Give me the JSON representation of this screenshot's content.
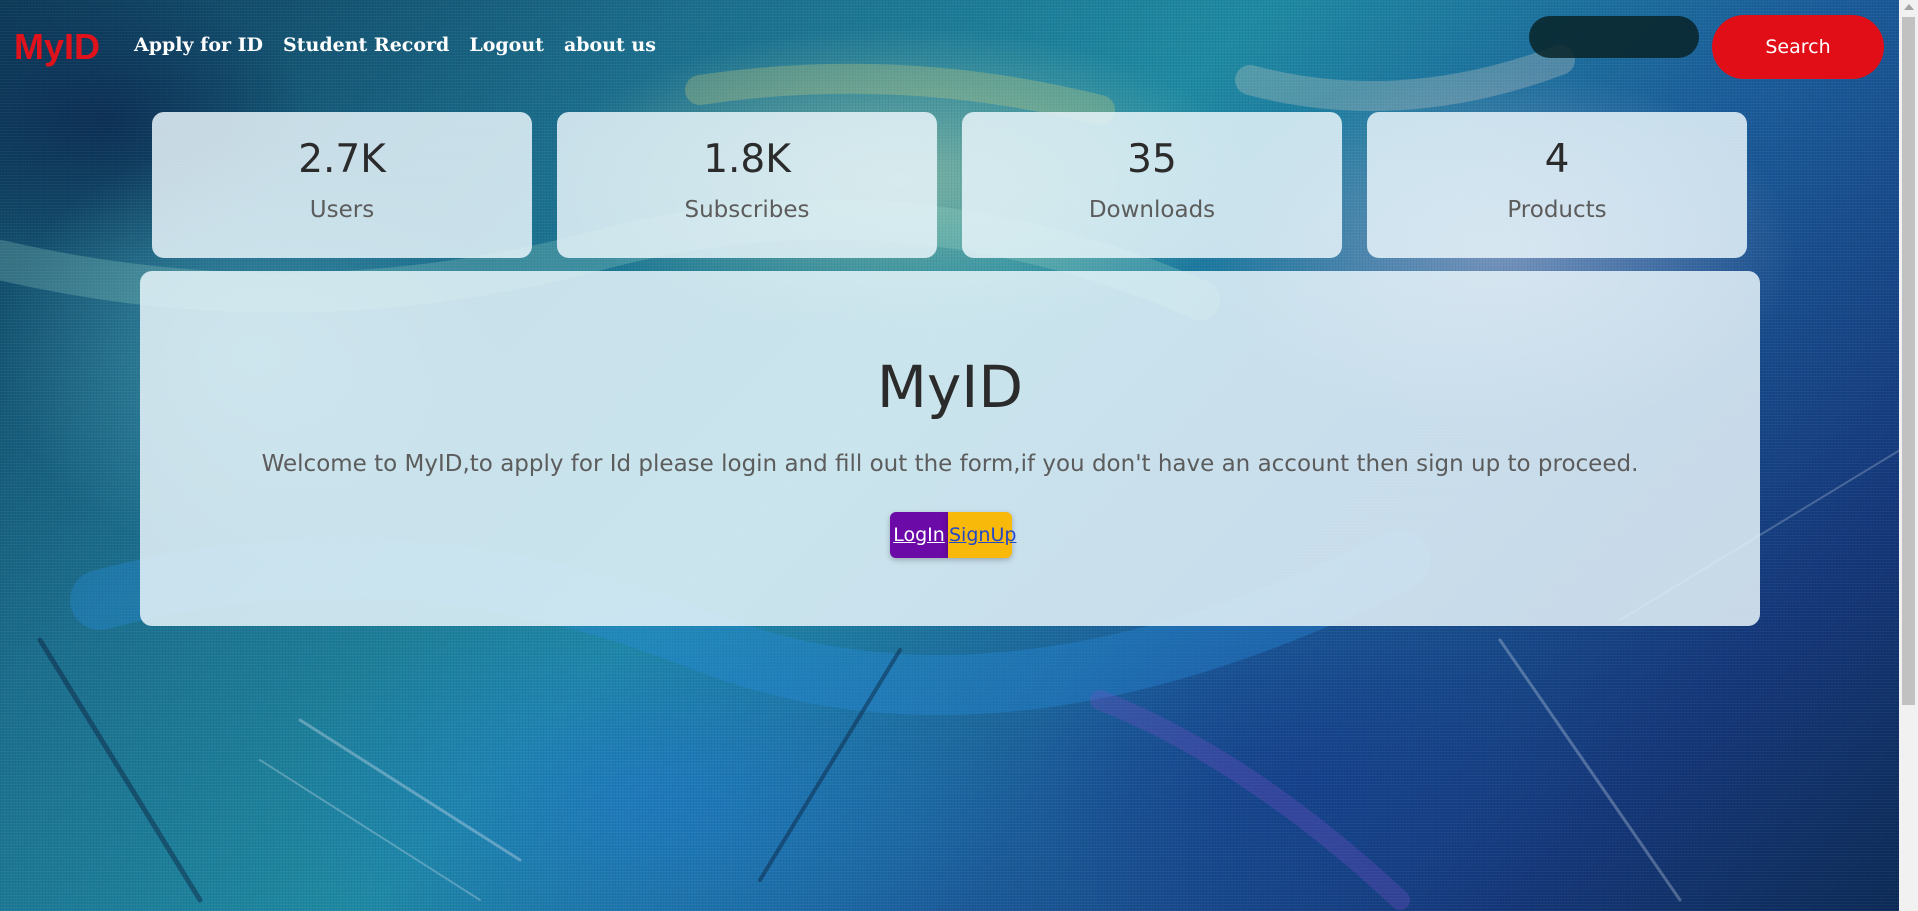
{
  "navbar": {
    "brand": "MyID",
    "links": [
      "Apply for ID",
      "Student Record",
      "Logout",
      "about us"
    ],
    "search": {
      "placeholder": "",
      "value": "",
      "button_label": "Search"
    }
  },
  "stats": [
    {
      "value": "2.7K",
      "label": "Users"
    },
    {
      "value": "1.8K",
      "label": "Subscribes"
    },
    {
      "value": "35",
      "label": "Downloads"
    },
    {
      "value": "4",
      "label": "Products"
    }
  ],
  "hero": {
    "title": "MyID",
    "text": "Welcome to MyID,to apply for Id please login and fill out the form,if you don't have an account then sign up to proceed.",
    "login_label": "LogIn",
    "signup_label": "SignUp"
  },
  "colors": {
    "brand": "#e0121c",
    "search_button": "#e10e18",
    "login_button": "#6b0aa6",
    "signup_button": "#f8b90a"
  }
}
